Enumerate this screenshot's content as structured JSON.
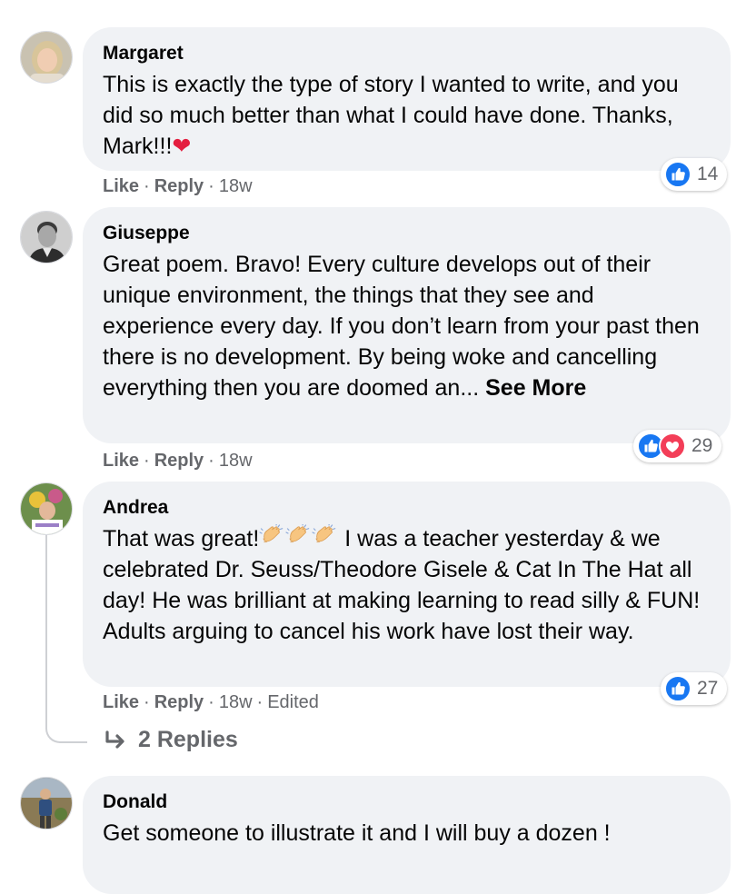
{
  "comments": [
    {
      "author": "Margaret",
      "text": "This is exactly the type of story I wanted to write, and you did so much better than what I could have done. Thanks, Mark!!!",
      "emoji": "❤",
      "actions": {
        "like": "Like",
        "reply": "Reply",
        "time": "18w"
      },
      "reactions": {
        "icons": [
          "like-icon"
        ],
        "count": "14"
      }
    },
    {
      "author": "Giuseppe",
      "text": "Great poem. Bravo! Every culture develops out of their unique environment, the things that they see and experience every day. If you don’t learn from your past then there is no development. By being woke and cancelling everything then you are doomed an...",
      "see_more": "See More",
      "actions": {
        "like": "Like",
        "reply": "Reply",
        "time": "18w"
      },
      "reactions": {
        "icons": [
          "like-icon",
          "love-icon"
        ],
        "count": "29"
      }
    },
    {
      "author": "Andrea",
      "text_start": "That was great!",
      "text_end": " I was a teacher yesterday & we celebrated Dr. Seuss/Theodore Gisele & Cat In The Hat all day! He was brilliant at making learning to read silly & FUN! Adults arguing to cancel his work have lost their way.",
      "actions": {
        "like": "Like",
        "reply": "Reply",
        "time": "18w",
        "edited": "Edited"
      },
      "reactions": {
        "icons": [
          "like-icon"
        ],
        "count": "27"
      },
      "replies_label": "2 Replies"
    },
    {
      "author": "Donald",
      "text": "Get someone to illustrate it and I will buy a dozen !"
    }
  ],
  "colors": {
    "bubble": "#f0f2f5",
    "like_blue": "#1877f2",
    "love_red": "#f33e58",
    "meta_gray": "#65676b"
  }
}
